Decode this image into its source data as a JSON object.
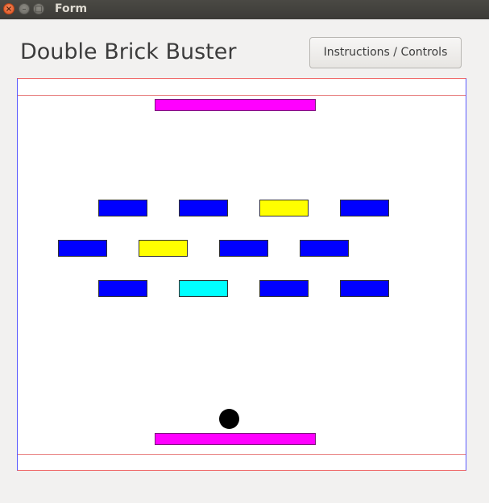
{
  "window": {
    "title": "Form",
    "controls": {
      "close": "×",
      "minimize": "–",
      "maximize": "□"
    }
  },
  "game": {
    "title": "Double Brick Buster",
    "instructions_label": "Instructions / Controls"
  },
  "colors": {
    "paddle": "#ff00ff",
    "ball": "#000000",
    "brick_blue": "#0000ff",
    "brick_yellow": "#ffff00",
    "brick_cyan": "#00ffff"
  },
  "bricks": {
    "rows": [
      [
        "blue",
        "blue",
        "yellow",
        "blue"
      ],
      [
        "blue",
        "yellow",
        "blue",
        "blue"
      ],
      [
        "blue",
        "cyan",
        "blue",
        "blue"
      ]
    ]
  }
}
